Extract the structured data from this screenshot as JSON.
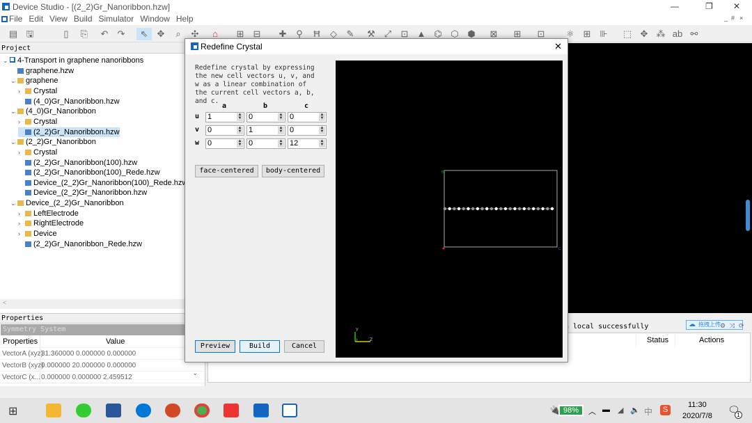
{
  "window": {
    "title": "Device Studio - [(2_2)Gr_Nanoribbon.hzw]",
    "controls": [
      "—",
      "❐",
      "✕"
    ],
    "mdi_controls": [
      "_",
      "#",
      "×"
    ]
  },
  "menu": [
    "File",
    "Edit",
    "View",
    "Build",
    "Simulator",
    "Window",
    "Help"
  ],
  "project_panel": {
    "title": "Project",
    "tree": [
      {
        "label": "4-Transport in graphene nanoribbons",
        "level": 0,
        "type": "project",
        "expanded": true
      },
      {
        "label": "graphene.hzw",
        "level": 1,
        "type": "file"
      },
      {
        "label": "graphene",
        "level": 1,
        "type": "folder",
        "expanded": true
      },
      {
        "label": "Crystal",
        "level": 2,
        "type": "folder",
        "expanded": false
      },
      {
        "label": "(4_0)Gr_Nanoribbon.hzw",
        "level": 2,
        "type": "file"
      },
      {
        "label": "(4_0)Gr_Nanoribbon",
        "level": 1,
        "type": "folder",
        "expanded": true
      },
      {
        "label": "Crystal",
        "level": 2,
        "type": "folder",
        "expanded": false
      },
      {
        "label": "(2_2)Gr_Nanoribbon.hzw",
        "level": 2,
        "type": "file",
        "selected": true
      },
      {
        "label": "(2_2)Gr_Nanoribbon",
        "level": 1,
        "type": "folder",
        "expanded": true
      },
      {
        "label": "Crystal",
        "level": 2,
        "type": "folder",
        "expanded": false
      },
      {
        "label": "(2_2)Gr_Nanoribbon(100).hzw",
        "level": 2,
        "type": "file"
      },
      {
        "label": "(2_2)Gr_Nanoribbon(100)_Rede.hzw",
        "level": 2,
        "type": "file"
      },
      {
        "label": "Device_(2_2)Gr_Nanoribbon(100)_Rede.hzw",
        "level": 2,
        "type": "file"
      },
      {
        "label": "Device_(2_2)Gr_Nanoribbon.hzw",
        "level": 2,
        "type": "file"
      },
      {
        "label": "Device_(2_2)Gr_Nanoribbon",
        "level": 1,
        "type": "folder",
        "expanded": true
      },
      {
        "label": "LeftElectrode",
        "level": 2,
        "type": "folder",
        "expanded": false
      },
      {
        "label": "RightElectrode",
        "level": 2,
        "type": "folder",
        "expanded": false
      },
      {
        "label": "Device",
        "level": 2,
        "type": "folder",
        "expanded": false
      },
      {
        "label": "(2_2)Gr_Nanoribbon_Rede.hzw",
        "level": 2,
        "type": "file"
      }
    ]
  },
  "properties_panel": {
    "title": "Properties",
    "section": "Symmetry System",
    "headers": [
      "Properties",
      "Value"
    ],
    "rows": [
      [
        "VectorA (xyz)",
        "31.360000 0.000000 0.000000"
      ],
      [
        "VectorB (xyz)",
        "0.000000 20.000000 0.000000"
      ],
      [
        "VectorC (x...",
        "0.000000 0.000000 2.459512"
      ]
    ]
  },
  "log": {
    "text": "n local successfully",
    "columns": [
      "Status",
      "Actions"
    ],
    "upload_badge": "拖拽上传"
  },
  "dialog": {
    "title": "Redefine Crystal",
    "close": "✕",
    "description": "Redefine crystal by expressing the new  cell vectors u, v, and w as a linear combination of the current cell vectors a, b, and c.",
    "col_headers": [
      "a",
      "b",
      "c"
    ],
    "rows": [
      {
        "label": "u",
        "values": [
          "1",
          "0",
          "0"
        ]
      },
      {
        "label": "v",
        "values": [
          "0",
          "1",
          "0"
        ]
      },
      {
        "label": "w",
        "values": [
          "0",
          "0",
          "12"
        ]
      }
    ],
    "face_centered": "face-centered",
    "body_centered": "body-centered",
    "preview": "Preview",
    "build": "Build",
    "cancel": "Cancel",
    "viewport": {
      "corner_labels": {
        "b": "B",
        "c": "C"
      },
      "axes": {
        "y": "Y",
        "z": "Z",
        "x": "X"
      },
      "atoms": 24
    }
  },
  "taskbar": {
    "battery": "98%",
    "ime": "中",
    "time": "11:30",
    "date": "2020/7/8",
    "notifications": "1"
  },
  "colors": {
    "accent": "#1565c0",
    "viewport_bg": "#000000",
    "battery": "#2e9e4f",
    "selection": "#cce4f7"
  }
}
